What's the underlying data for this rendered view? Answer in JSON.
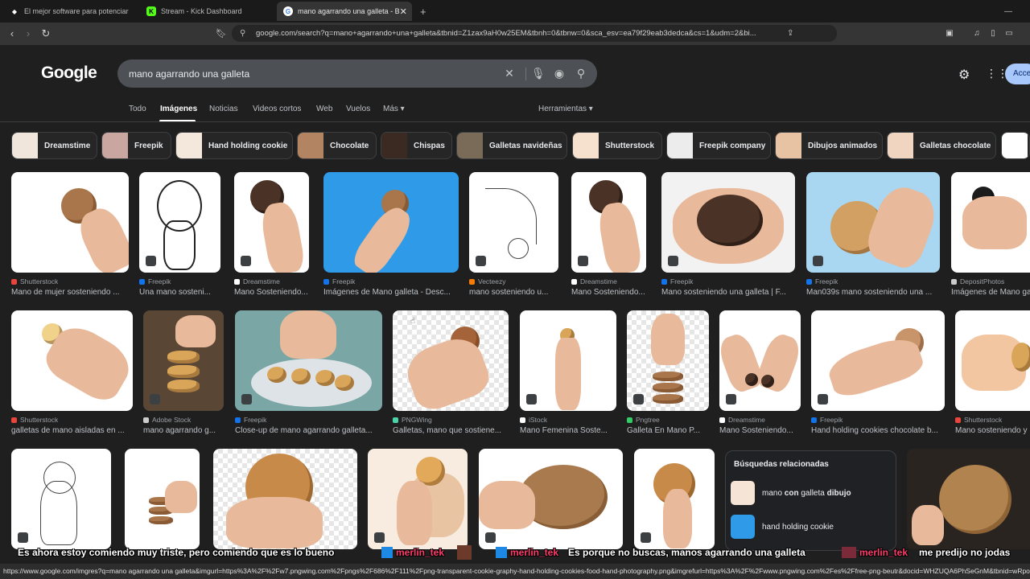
{
  "browser": {
    "tabs": [
      {
        "label": "El mejor software para potenciar",
        "favicon_color": "#ffffff"
      },
      {
        "label": "Stream - Kick Dashboard",
        "favicon_color": "#53fc18",
        "favicon_glyph": "K"
      },
      {
        "label": "mano agarrando una galleta - B",
        "favicon_color": "#4285f4",
        "favicon_glyph": "G"
      }
    ],
    "new_tab": "+",
    "url": "google.com/search?q=mano+agarrando+una+galleta&tbnid=Z1zax9aH0w25EM&tbnh=0&tbnw=0&sca_esv=ea79f29eab3dedca&cs=1&udm=2&bi...",
    "minimize": "—"
  },
  "google": {
    "logo": "Google",
    "query": "mano agarrando una galleta",
    "sign_in": "Acce",
    "tabs": [
      "Todo",
      "Imágenes",
      "Noticias",
      "Videos cortos",
      "Web",
      "Vuelos",
      "Más ▾"
    ],
    "tools": "Herramientas ▾",
    "chips": [
      "Dreamstime",
      "Freepik",
      "Hand holding cookie",
      "Chocolate",
      "Chispas",
      "Galletas navideñas",
      "Shutterstock",
      "Freepik company",
      "Dibujos animados",
      "Galletas chocolate"
    ]
  },
  "results": [
    {
      "source": "Shutterstock",
      "title": "Mano de mujer sosteniendo ...",
      "fav": "#e8453c"
    },
    {
      "source": "Freepik",
      "title": "Una mano sosteni...",
      "fav": "#1273eb"
    },
    {
      "source": "Dreamstime",
      "title": "Mano Sosteniendo...",
      "fav": "#ffffff"
    },
    {
      "source": "Freepik",
      "title": "Imágenes de Mano galleta - Desc...",
      "fav": "#1273eb"
    },
    {
      "source": "Vecteezy",
      "title": "mano sosteniendo u...",
      "fav": "#f57c00"
    },
    {
      "source": "Dreamstime",
      "title": "Mano Sosteniendo...",
      "fav": "#ffffff"
    },
    {
      "source": "Freepik",
      "title": "Mano sosteniendo una galleta | F...",
      "fav": "#1273eb"
    },
    {
      "source": "Freepik",
      "title": "Man039s mano sosteniendo una ...",
      "fav": "#1273eb"
    },
    {
      "source": "DepositPhotos",
      "title": "Imágenes de Mano ga",
      "fav": "#cccccc"
    },
    {
      "source": "Shutterstock",
      "title": "galletas de mano aisladas en ...",
      "fav": "#e8453c"
    },
    {
      "source": "Adobe Stock",
      "title": "mano agarrando g...",
      "fav": "#cccccc"
    },
    {
      "source": "Freepik",
      "title": "Close-up de mano agarrando galleta...",
      "fav": "#1273eb"
    },
    {
      "source": "PNGWing",
      "title": "Galletas, mano que sostiene...",
      "fav": "#4ad4a8"
    },
    {
      "source": "iStock",
      "title": "Mano Femenina Soste...",
      "fav": "#ffffff",
      "glyph": "iS"
    },
    {
      "source": "Pngtree",
      "title": "Galleta En Mano P...",
      "fav": "#33cc66"
    },
    {
      "source": "Dreamstime",
      "title": "Mano Sosteniendo...",
      "fav": "#ffffff"
    },
    {
      "source": "Freepik",
      "title": "Hand holding cookies chocolate b...",
      "fav": "#1273eb"
    },
    {
      "source": "Shutterstock",
      "title": "Mano sosteniendo y",
      "fav": "#e8453c"
    }
  ],
  "related": {
    "heading": "Búsquedas relacionadas",
    "items": [
      {
        "pre": "mano ",
        "bold": "con",
        "mid": " galleta ",
        "bold2": "dibujo"
      },
      {
        "pre": "hand holding cookie",
        "bold": "",
        "mid": "",
        "bold2": ""
      }
    ]
  },
  "chat": [
    {
      "user": "",
      "text": "Es ahora estoy comiendo muy triste, pero comiendo que es lo bueno"
    },
    {
      "user": "merlin_tek",
      "text": "Es porque no buscas, manos agarrando una galleta"
    },
    {
      "user": "merlin_tek",
      "text": "me predijo no jodas"
    }
  ],
  "status_url": "https://www.google.com/imgres?q=mano agarrando una galleta&imgurl=https%3A%2F%2Fw7.pngwing.com%2Fpngs%2F686%2F111%2Fpng-transparent-cookie-graphy-hand-holding-cookies-food-hand-photography.png&imgrefurl=https%3A%2F%2Fwww.pngwing.com%2Fes%2Ffree-png-beutr&docid=WHZUQA6PhSeGnM&tbnid=wRpo58kM"
}
